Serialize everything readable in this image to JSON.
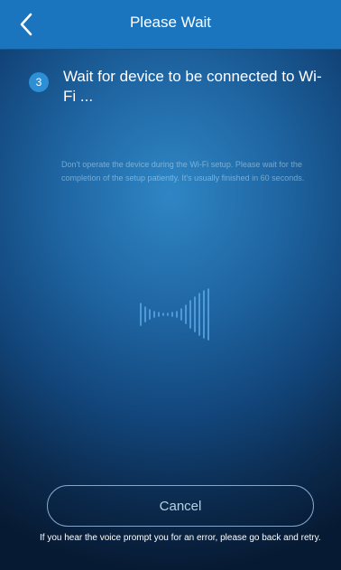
{
  "header": {
    "title": "Please Wait",
    "back_icon": "chevron-left-icon"
  },
  "step": {
    "number": "3",
    "text": "Wait for device to be connected to Wi-Fi ..."
  },
  "notice": {
    "text": "Don't operate the device during the Wi-Fi setup. Please wait for the completion of the setup patiently. It's usually finished in 60 seconds."
  },
  "animation": {
    "icon": "signal-wave-icon"
  },
  "actions": {
    "cancel_label": "Cancel"
  },
  "footer": {
    "note": "If you hear the voice prompt you for an error, please go back and retry."
  },
  "colors": {
    "header_bg": "#1b74be",
    "accent": "#2d8fd6"
  }
}
